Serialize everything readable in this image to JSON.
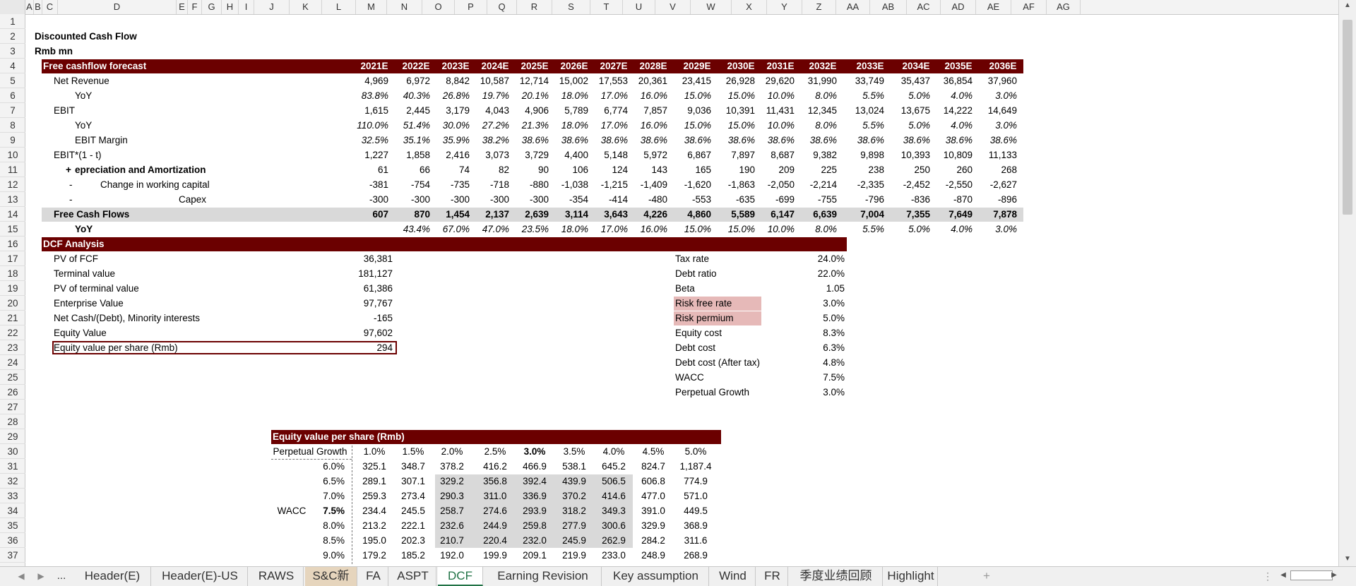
{
  "columns": [
    "A",
    "B",
    "C",
    "D",
    "E",
    "F",
    "G",
    "H",
    "I",
    "J",
    "K",
    "L",
    "M",
    "N",
    "O",
    "P",
    "Q",
    "R",
    "S",
    "T",
    "U",
    "V",
    "W",
    "X",
    "Y",
    "Z",
    "AA",
    "AB",
    "AC",
    "AD",
    "AE",
    "AF",
    "AG"
  ],
  "rows": [
    "1",
    "2",
    "3",
    "4",
    "5",
    "6",
    "7",
    "8",
    "9",
    "10",
    "11",
    "12",
    "13",
    "14",
    "15",
    "16",
    "17",
    "18",
    "19",
    "20",
    "21",
    "22",
    "23",
    "24",
    "25",
    "26",
    "27",
    "28",
    "29",
    "30",
    "31",
    "32",
    "33",
    "34",
    "35",
    "36",
    "37"
  ],
  "title": "Discounted Cash Flow",
  "units": "Rmb mn",
  "forecast": {
    "header": "Free cashflow forecast",
    "years": [
      "2021E",
      "2022E",
      "2023E",
      "2024E",
      "2025E",
      "2026E",
      "2027E",
      "2028E",
      "2029E",
      "2030E",
      "2031E",
      "2032E",
      "2033E",
      "2034E",
      "2035E",
      "2036E"
    ],
    "rows": [
      {
        "label": "Net Revenue",
        "style": "lvl1",
        "values": [
          "4,969",
          "6,972",
          "8,842",
          "10,587",
          "12,714",
          "15,002",
          "17,553",
          "20,361",
          "23,415",
          "26,928",
          "29,620",
          "31,990",
          "33,749",
          "35,437",
          "36,854",
          "37,960"
        ]
      },
      {
        "label": "YoY",
        "style": "lvl2",
        "italic": true,
        "values": [
          "83.8%",
          "40.3%",
          "26.8%",
          "19.7%",
          "20.1%",
          "18.0%",
          "17.0%",
          "16.0%",
          "15.0%",
          "15.0%",
          "10.0%",
          "8.0%",
          "5.5%",
          "5.0%",
          "4.0%",
          "3.0%"
        ]
      },
      {
        "label": "EBIT",
        "style": "lvl1",
        "values": [
          "1,615",
          "2,445",
          "3,179",
          "4,043",
          "4,906",
          "5,789",
          "6,774",
          "7,857",
          "9,036",
          "10,391",
          "11,431",
          "12,345",
          "13,024",
          "13,675",
          "14,222",
          "14,649"
        ]
      },
      {
        "label": "YoY",
        "style": "lvl2",
        "italic": true,
        "values": [
          "110.0%",
          "51.4%",
          "30.0%",
          "27.2%",
          "21.3%",
          "18.0%",
          "17.0%",
          "16.0%",
          "15.0%",
          "15.0%",
          "10.0%",
          "8.0%",
          "5.5%",
          "5.0%",
          "4.0%",
          "3.0%"
        ]
      },
      {
        "label": "EBIT Margin",
        "style": "lvl2",
        "italic": true,
        "values": [
          "32.5%",
          "35.1%",
          "35.9%",
          "38.2%",
          "38.6%",
          "38.6%",
          "38.6%",
          "38.6%",
          "38.6%",
          "38.6%",
          "38.6%",
          "38.6%",
          "38.6%",
          "38.6%",
          "38.6%",
          "38.6%"
        ]
      },
      {
        "label": "EBIT*(1 - t)",
        "style": "lvl1",
        "values": [
          "1,227",
          "1,858",
          "2,416",
          "3,073",
          "3,729",
          "4,400",
          "5,148",
          "5,972",
          "6,867",
          "7,897",
          "8,687",
          "9,382",
          "9,898",
          "10,393",
          "10,809",
          "11,133"
        ]
      },
      {
        "label": "epreciation and Amortization",
        "sign": "+",
        "style": "da",
        "bold": true,
        "values": [
          "61",
          "66",
          "74",
          "82",
          "90",
          "106",
          "124",
          "143",
          "165",
          "190",
          "209",
          "225",
          "238",
          "250",
          "260",
          "268"
        ]
      },
      {
        "label": "Change in working capital",
        "sign": "-",
        "style": "wc",
        "values": [
          "-381",
          "-754",
          "-735",
          "-718",
          "-880",
          "-1,038",
          "-1,215",
          "-1,409",
          "-1,620",
          "-1,863",
          "-2,050",
          "-2,214",
          "-2,335",
          "-2,452",
          "-2,550",
          "-2,627"
        ]
      },
      {
        "label": "Capex",
        "sign": "-",
        "style": "capex",
        "values": [
          "-300",
          "-300",
          "-300",
          "-300",
          "-300",
          "-354",
          "-414",
          "-480",
          "-553",
          "-635",
          "-699",
          "-755",
          "-796",
          "-836",
          "-870",
          "-896"
        ]
      },
      {
        "label": "Free Cash Flows",
        "style": "fcf",
        "bold": true,
        "values": [
          "607",
          "870",
          "1,454",
          "2,137",
          "2,639",
          "3,114",
          "3,643",
          "4,226",
          "4,860",
          "5,589",
          "6,147",
          "6,639",
          "7,004",
          "7,355",
          "7,649",
          "7,878"
        ]
      },
      {
        "label": "YoY",
        "style": "fcfyoy",
        "bold": true,
        "italic": true,
        "values": [
          "",
          "43.4%",
          "67.0%",
          "47.0%",
          "23.5%",
          "18.0%",
          "17.0%",
          "16.0%",
          "15.0%",
          "15.0%",
          "10.0%",
          "8.0%",
          "5.5%",
          "5.0%",
          "4.0%",
          "3.0%"
        ]
      }
    ]
  },
  "dcf": {
    "header": "DCF Analysis",
    "left": [
      {
        "label": "PV of FCF",
        "value": "36,381"
      },
      {
        "label": "Terminal value",
        "value": "181,127"
      },
      {
        "label": "PV of terminal value",
        "value": "61,386"
      },
      {
        "label": "Enterprise Value",
        "value": "97,767"
      },
      {
        "label": "Net Cash/(Debt), Minority interests",
        "value": "-165"
      },
      {
        "label": "Equity Value",
        "value": "97,602"
      },
      {
        "label": "Equity value per share (Rmb)",
        "value": "294"
      }
    ],
    "right": [
      {
        "label": "Tax rate",
        "value": "24.0%"
      },
      {
        "label": "Debt ratio",
        "value": "22.0%"
      },
      {
        "label": "Beta",
        "value": "1.05"
      },
      {
        "label": "Risk free rate",
        "value": "3.0%",
        "pink": true
      },
      {
        "label": "Risk permium",
        "value": "5.0%",
        "pink": true
      },
      {
        "label": "Equity cost",
        "value": "8.3%"
      },
      {
        "label": "Debt cost",
        "value": "6.3%"
      },
      {
        "label": "Debt cost (After tax)",
        "value": "4.8%"
      },
      {
        "label": "WACC",
        "value": "7.5%"
      },
      {
        "label": "Perpetual Growth",
        "value": "3.0%"
      }
    ]
  },
  "sensitivity": {
    "header": "Equity value per share (Rmb)",
    "col_label": "Perpetual Growth",
    "row_label": "WACC",
    "growth": [
      "1.0%",
      "1.5%",
      "2.0%",
      "2.5%",
      "3.0%",
      "3.5%",
      "4.0%",
      "4.5%",
      "5.0%"
    ],
    "wacc": [
      "6.0%",
      "6.5%",
      "7.0%",
      "7.5%",
      "8.0%",
      "8.5%",
      "9.0%"
    ],
    "values": [
      [
        "325.1",
        "348.7",
        "378.2",
        "416.2",
        "466.9",
        "538.1",
        "645.2",
        "824.7",
        "1,187.4"
      ],
      [
        "289.1",
        "307.1",
        "329.2",
        "356.8",
        "392.4",
        "439.9",
        "506.5",
        "606.8",
        "774.9"
      ],
      [
        "259.3",
        "273.4",
        "290.3",
        "311.0",
        "336.9",
        "370.2",
        "414.6",
        "477.0",
        "571.0"
      ],
      [
        "234.4",
        "245.5",
        "258.7",
        "274.6",
        "293.9",
        "318.2",
        "349.3",
        "391.0",
        "449.5"
      ],
      [
        "213.2",
        "222.1",
        "232.6",
        "244.9",
        "259.8",
        "277.9",
        "300.6",
        "329.9",
        "368.9"
      ],
      [
        "195.0",
        "202.3",
        "210.7",
        "220.4",
        "232.0",
        "245.9",
        "262.9",
        "284.2",
        "311.6"
      ],
      [
        "179.2",
        "185.2",
        "192.0",
        "199.9",
        "209.1",
        "219.9",
        "233.0",
        "248.9",
        "268.9"
      ]
    ]
  },
  "tabs": [
    "Header(E)",
    "Header(E)-US",
    "RAWS",
    "S&C新",
    "FA",
    "ASPT",
    "DCF",
    "Earning Revision",
    "Key assumption",
    "Wind",
    "FR",
    "季度业绩回顾",
    "Highlight"
  ],
  "tab_nav": {
    "prev": "◀",
    "next": "▶",
    "more": "..."
  },
  "scroll": {
    "up": "▲",
    "down": "▼",
    "left": "◀",
    "right": "▶"
  },
  "new_sheet": "+",
  "options": "⋮",
  "colors": {
    "header_red": "#6b0000",
    "grey": "#d9d9d9",
    "pink": "#e6b9b8",
    "accent": "#217346"
  }
}
